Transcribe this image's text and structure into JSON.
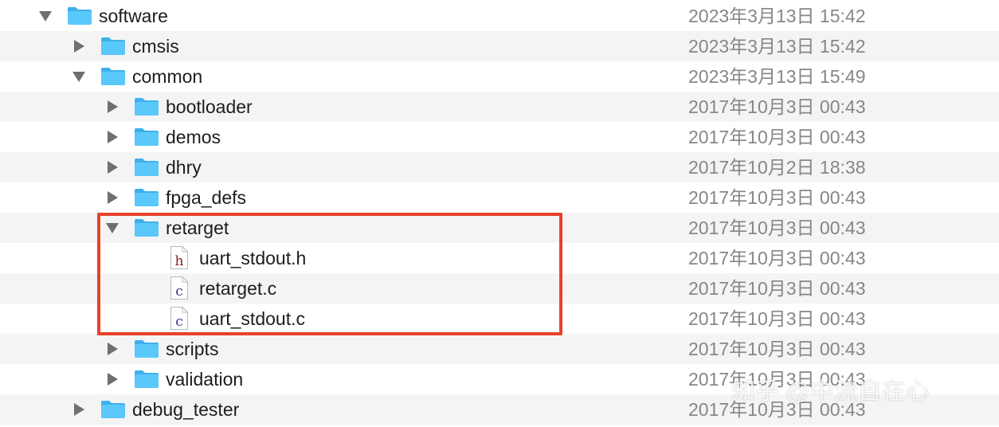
{
  "colors": {
    "folder": "#5ac8fa",
    "highlight": "#e8412c",
    "stripe": "#f4f4f5",
    "date_text": "#86868b"
  },
  "rows": [
    {
      "name": "software",
      "date": "2023年3月13日 15:42",
      "depth": 0,
      "kind": "folder",
      "disclosure": "expanded",
      "icon": "folder-icon"
    },
    {
      "name": "cmsis",
      "date": "2023年3月13日 15:42",
      "depth": 1,
      "kind": "folder",
      "disclosure": "collapsed",
      "icon": "folder-icon"
    },
    {
      "name": "common",
      "date": "2023年3月13日 15:49",
      "depth": 1,
      "kind": "folder",
      "disclosure": "expanded",
      "icon": "folder-icon"
    },
    {
      "name": "bootloader",
      "date": "2017年10月3日 00:43",
      "depth": 2,
      "kind": "folder",
      "disclosure": "collapsed",
      "icon": "folder-icon"
    },
    {
      "name": "demos",
      "date": "2017年10月3日 00:43",
      "depth": 2,
      "kind": "folder",
      "disclosure": "collapsed",
      "icon": "folder-icon"
    },
    {
      "name": "dhry",
      "date": "2017年10月2日 18:38",
      "depth": 2,
      "kind": "folder",
      "disclosure": "collapsed",
      "icon": "folder-icon"
    },
    {
      "name": "fpga_defs",
      "date": "2017年10月3日 00:43",
      "depth": 2,
      "kind": "folder",
      "disclosure": "collapsed",
      "icon": "folder-icon"
    },
    {
      "name": "retarget",
      "date": "2017年10月3日 00:43",
      "depth": 2,
      "kind": "folder",
      "disclosure": "expanded",
      "icon": "folder-icon"
    },
    {
      "name": "uart_stdout.h",
      "date": "2017年10月3日 00:43",
      "depth": 3,
      "kind": "file",
      "file_letter": "h",
      "letter_color": "#8b1a1a",
      "icon": "h-file-icon"
    },
    {
      "name": "retarget.c",
      "date": "2017年10月3日 00:43",
      "depth": 3,
      "kind": "file",
      "file_letter": "c",
      "letter_color": "#4b2a8a",
      "icon": "c-file-icon"
    },
    {
      "name": "uart_stdout.c",
      "date": "2017年10月3日 00:43",
      "depth": 3,
      "kind": "file",
      "file_letter": "c",
      "letter_color": "#4b2a8a",
      "icon": "c-file-icon"
    },
    {
      "name": "scripts",
      "date": "2017年10月3日 00:43",
      "depth": 2,
      "kind": "folder",
      "disclosure": "collapsed",
      "icon": "folder-icon"
    },
    {
      "name": "validation",
      "date": "2017年10月3日 00:43",
      "depth": 2,
      "kind": "folder",
      "disclosure": "collapsed",
      "icon": "folder-icon"
    },
    {
      "name": "debug_tester",
      "date": "2017年10月3日 00:43",
      "depth": 1,
      "kind": "folder",
      "disclosure": "collapsed",
      "icon": "folder-icon"
    }
  ],
  "watermark": "知乎 @中流自在心"
}
